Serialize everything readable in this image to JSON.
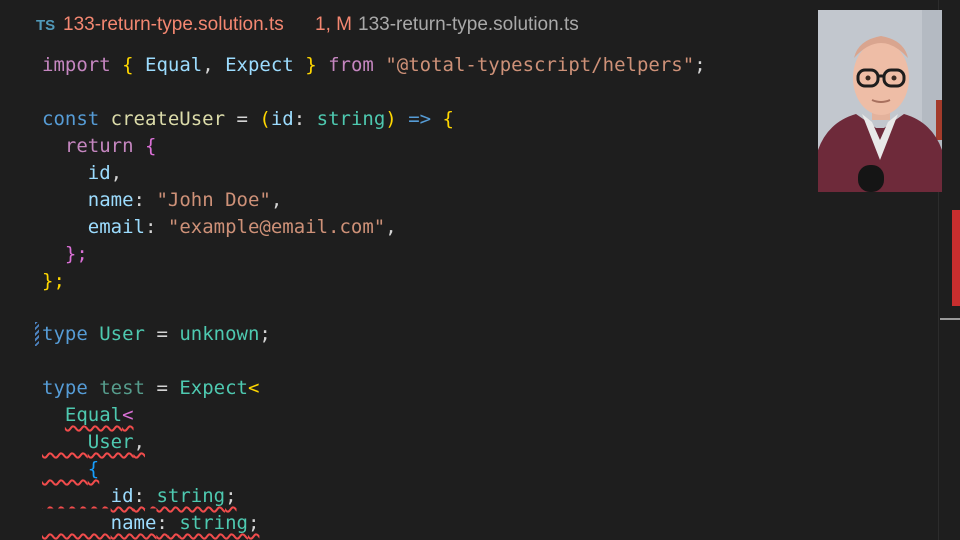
{
  "tab": {
    "language_badge": "TS",
    "filename": "133-return-type.solution.ts",
    "status": "1, M",
    "breadcrumb": "133-return-type.solution.ts"
  },
  "code": {
    "line1": {
      "import": "import",
      "lbrace": "{",
      "equal": "Equal",
      "comma": ",",
      "expect": "Expect",
      "rbrace": "}",
      "from": "from",
      "module": "\"@total-typescript/helpers\"",
      "semi": ";"
    },
    "line3": {
      "const": "const",
      "name": "createUser",
      "eq": "=",
      "lparen": "(",
      "param": "id",
      "colon": ":",
      "ptype": "string",
      "rparen": ")",
      "arrow": "=>",
      "lbrace": "{"
    },
    "line4": {
      "return": "return",
      "lbrace": "{"
    },
    "line5": {
      "id": "id",
      "comma": ","
    },
    "line6": {
      "key": "name",
      "colon": ":",
      "value": "\"John Doe\"",
      "comma": ","
    },
    "line7": {
      "key": "email",
      "colon": ":",
      "value": "\"example@email.com\"",
      "comma": ","
    },
    "line8": {
      "text": "};"
    },
    "line9": {
      "text": "};"
    },
    "line11": {
      "type": "type",
      "name": "User",
      "eq": "=",
      "value": "unknown",
      "semi": ";"
    },
    "line13": {
      "type": "type",
      "name": "test",
      "eq": "=",
      "expect": "Expect",
      "lt": "<"
    },
    "line14": {
      "equal": "Equal",
      "lt": "<"
    },
    "line15": {
      "user": "User",
      "comma": ","
    },
    "line16": {
      "lbrace": "{"
    },
    "line17": {
      "key": "id",
      "colon": ":",
      "value": "string",
      "semi": ";"
    },
    "line18": {
      "key": "name",
      "colon": ":",
      "value": "string",
      "semi": ";"
    }
  },
  "webcam": {
    "description_icon": "presenter-webcam"
  },
  "colors": {
    "background": "#1e1e1e",
    "error": "#f14c4c",
    "tab_modified": "#f48771"
  }
}
